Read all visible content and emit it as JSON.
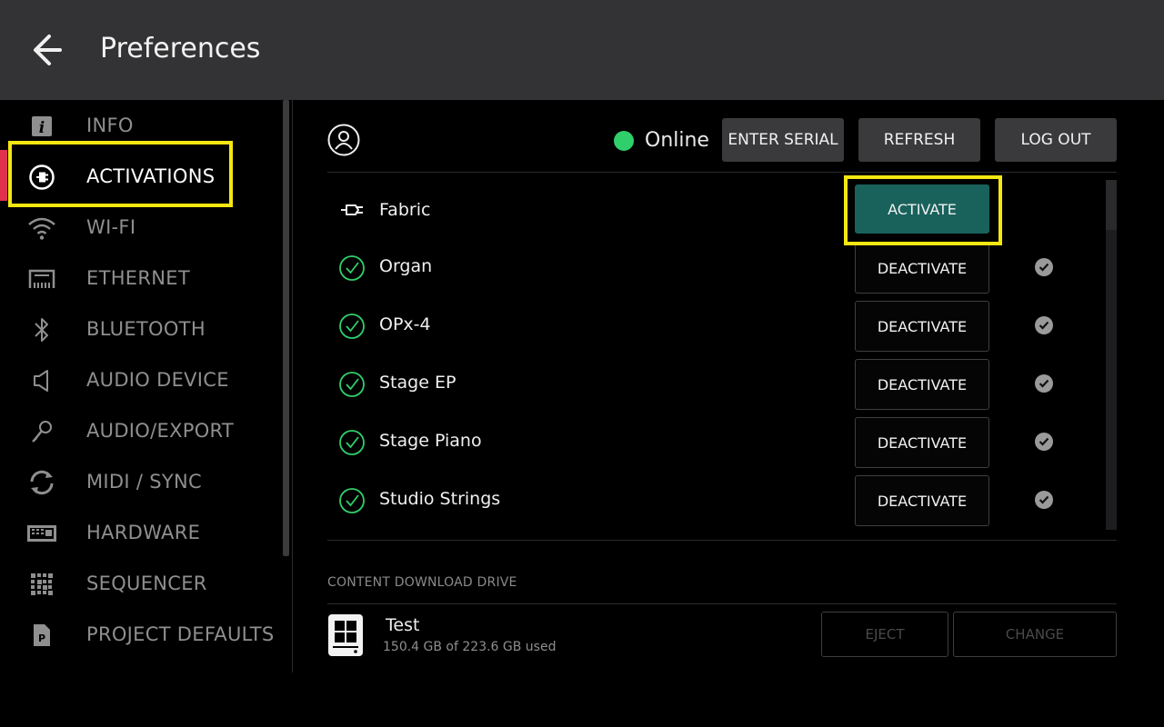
{
  "header": {
    "title": "Preferences"
  },
  "sidebar": {
    "items": [
      {
        "label": "INFO",
        "icon": "info-icon"
      },
      {
        "label": "ACTIVATIONS",
        "icon": "plug-icon",
        "active": true
      },
      {
        "label": "WI-FI",
        "icon": "wifi-icon"
      },
      {
        "label": "ETHERNET",
        "icon": "ethernet-icon"
      },
      {
        "label": "BLUETOOTH",
        "icon": "bluetooth-icon"
      },
      {
        "label": "AUDIO DEVICE",
        "icon": "speaker-icon"
      },
      {
        "label": "AUDIO/EXPORT",
        "icon": "microphone-icon"
      },
      {
        "label": "MIDI / SYNC",
        "icon": "sync-icon"
      },
      {
        "label": "HARDWARE",
        "icon": "keyboard-icon"
      },
      {
        "label": "SEQUENCER",
        "icon": "grid-icon"
      },
      {
        "label": "PROJECT DEFAULTS",
        "icon": "document-icon"
      }
    ]
  },
  "account": {
    "status": "Online",
    "status_color": "#2fcf6b",
    "enter_serial_label": "ENTER SERIAL",
    "refresh_label": "REFRESH",
    "logout_label": "LOG OUT"
  },
  "activations": [
    {
      "name": "Fabric",
      "state": "inactive",
      "button": "ACTIVATE"
    },
    {
      "name": "Organ",
      "state": "active",
      "button": "DEACTIVATE"
    },
    {
      "name": "OPx-4",
      "state": "active",
      "button": "DEACTIVATE"
    },
    {
      "name": "Stage EP",
      "state": "active",
      "button": "DEACTIVATE"
    },
    {
      "name": "Stage Piano",
      "state": "active",
      "button": "DEACTIVATE"
    },
    {
      "name": "Studio Strings",
      "state": "active",
      "button": "DEACTIVATE"
    }
  ],
  "drive": {
    "section_label": "CONTENT DOWNLOAD DRIVE",
    "name": "Test",
    "usage": "150.4 GB of 223.6 GB used",
    "eject_label": "EJECT",
    "change_label": "CHANGE"
  },
  "colors": {
    "accent_activate": "#19625c",
    "highlight": "#f5e712",
    "active_indicator": "#e0324f"
  }
}
